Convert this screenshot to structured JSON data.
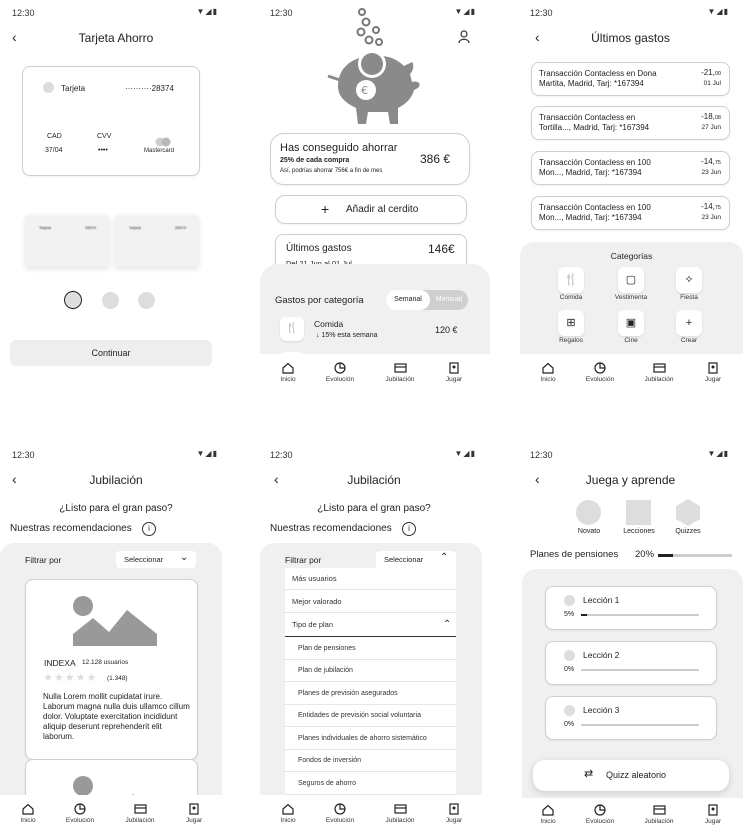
{
  "status": {
    "time": "12:30"
  },
  "nav": {
    "inicio": "Inicio",
    "evolucion": "Evolución",
    "jubilacion": "Jubilación",
    "jugar": "Jugar"
  },
  "s1": {
    "title": "Tarjeta Ahorro",
    "card_label": "Tarjeta",
    "card_number": "··········28374",
    "cad_label": "CAD",
    "cad_value": "37/04",
    "cvv_label": "CVV",
    "cvv_value": "••••",
    "brand": "Mastercard",
    "mini1_label": "Tarjeta",
    "mini1_number": "28374",
    "mini2_label": "Tarjeta",
    "mini2_number": "28374",
    "continue": "Continuar"
  },
  "s2": {
    "saved_title": "Has conseguido ahorrar",
    "saved_sub": "25% de cada compra",
    "saved_note": "Así, podrías ahorrar 756€ a fin de mes",
    "saved_amount": "386 €",
    "add_label": "Añadir al cerdito",
    "last_title": "Últimos gastos",
    "last_amount": "146€",
    "last_range": "Del 21 Jun al 01 Jul",
    "cat_title": "Gastos por categoría",
    "toggle_a": "Semanal",
    "toggle_b": "Mensual",
    "row_name": "Comida",
    "row_sub": "↓ 15% esta semana",
    "row_amount": "120 €"
  },
  "s3": {
    "title": "Últimos gastos",
    "tx": [
      {
        "l1": "Transacción Contacless en Dona",
        "l2": "Martita, Madrid, Tarj: *167394",
        "int": "-21,",
        "dec": "00",
        "date": "01 Jul"
      },
      {
        "l1": "Transacción Contacless en",
        "l2": "Tortilla..., Madrid, Tarj: *167394",
        "int": "-18,",
        "dec": "08",
        "date": "27 Jun"
      },
      {
        "l1": "Transacción Contacless en 100",
        "l2": "Mon..., Madrid, Tarj: *167394",
        "int": "-14,",
        "dec": "75",
        "date": "23 Jun"
      },
      {
        "l1": "Transacción Contacless en 100",
        "l2": "Mon..., Madrid, Tarj: *167394",
        "int": "-14,",
        "dec": "75",
        "date": "23 Jun"
      }
    ],
    "cats_title": "Categorías",
    "cats": [
      "Comida",
      "Vestimenta",
      "Fiesta",
      "Regalos",
      "Cine",
      "Crear"
    ]
  },
  "s4": {
    "title": "Jubilación",
    "question": "¿Listo para el gran paso?",
    "recs": "Nuestras recomendaciones",
    "filter": "Filtrar por",
    "select": "Seleccionar",
    "product": "INDEXA",
    "users": "12.128 usuarios",
    "rating": "(1.348)",
    "desc": "Nulla Lorem mollit cupidatat irure. Laborum magna nulla duis ullamco cillum dolor. Voluptate exercitation incididunt aliquip deserunt reprehenderit elit laborum."
  },
  "s5": {
    "title": "Jubilación",
    "question": "¿Listo para el gran paso?",
    "recs": "Nuestras recomendaciones",
    "filter": "Filtrar por",
    "select": "Seleccionar",
    "options": [
      "Más usuarios",
      "Mejor valorado",
      "Tipo de plan"
    ],
    "sub_options": [
      "Plan de pensiones",
      "Plan de jubilación",
      "Planes de previsión asegurados",
      "Entidades de previsión social voluntaria",
      "Planes individuales de ahorro sistemático",
      "Fondos de inversión",
      "Seguros de ahorro"
    ]
  },
  "s6": {
    "title": "Juega y aprende",
    "tabs": [
      "Novato",
      "Lecciones",
      "Quizzes"
    ],
    "plan_label": "Planes de pensiones",
    "plan_pct": "20%",
    "plan_progress": 0.2,
    "lessons": [
      {
        "name": "Lección 1",
        "pct": "5%",
        "progress": 0.05
      },
      {
        "name": "Lección 2",
        "pct": "0%",
        "progress": 0
      },
      {
        "name": "Lección 3",
        "pct": "0%",
        "progress": 0
      }
    ],
    "quiz": "Quizz aleatorio"
  }
}
